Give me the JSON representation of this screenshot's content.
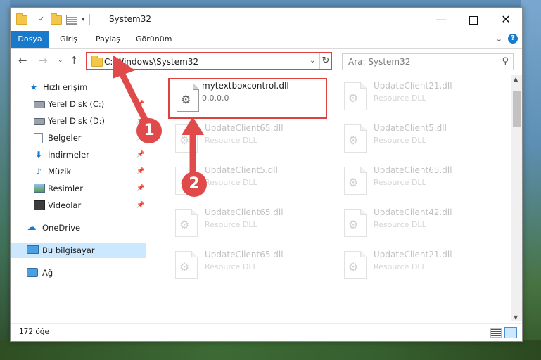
{
  "window": {
    "title": "System32",
    "qat_separator": "|",
    "qat_dropdown": "▾"
  },
  "ribbon": {
    "tabs": [
      "Dosya",
      "Giriş",
      "Paylaş",
      "Görünüm"
    ]
  },
  "navigation": {
    "address": "C:\\Windows\\System32",
    "search_placeholder": "Ara: System32"
  },
  "sidebar": {
    "items": [
      {
        "label": "Hızlı erişim",
        "icon": "star-icon"
      },
      {
        "label": "Yerel Disk (C:)",
        "icon": "drive-icon",
        "pinned": true
      },
      {
        "label": "Yerel Disk (D:)",
        "icon": "drive-icon",
        "pinned": true
      },
      {
        "label": "Belgeler",
        "icon": "documents-icon",
        "pinned": true
      },
      {
        "label": "İndirmeler",
        "icon": "download-icon",
        "pinned": true
      },
      {
        "label": "Müzik",
        "icon": "music-icon",
        "pinned": true
      },
      {
        "label": "Resimler",
        "icon": "pictures-icon",
        "pinned": true
      },
      {
        "label": "Videolar",
        "icon": "videos-icon",
        "pinned": true
      },
      {
        "label": "OneDrive",
        "icon": "onedrive-icon"
      },
      {
        "label": "Bu bilgisayar",
        "icon": "this-pc-icon",
        "selected": true
      },
      {
        "label": "Ağ",
        "icon": "network-icon"
      }
    ]
  },
  "files": [
    {
      "name": "mytextboxcontrol.dll",
      "sub": "0.0.0.0",
      "highlighted": true
    },
    {
      "name": "UpdateClient21.dll",
      "sub": "Resource DLL"
    },
    {
      "name": "UpdateClient65.dll",
      "sub": "Resource DLL"
    },
    {
      "name": "UpdateClient5.dll",
      "sub": "Resource DLL"
    },
    {
      "name": "UpdateClient5.dll",
      "sub": "Resource DLL"
    },
    {
      "name": "UpdateClient65.dll",
      "sub": "Resource DLL"
    },
    {
      "name": "UpdateClient65.dll",
      "sub": "Resource DLL"
    },
    {
      "name": "UpdateClient42.dll",
      "sub": "Resource DLL"
    },
    {
      "name": "UpdateClient65.dll",
      "sub": "Resource DLL"
    },
    {
      "name": "UpdateClient21.dll",
      "sub": "Resource DLL"
    }
  ],
  "status": {
    "item_count": "172 öğe"
  },
  "callouts": [
    "1",
    "2"
  ],
  "colors": {
    "accent": "#1979ca",
    "highlight_border": "#e04040",
    "callout_fill": "#e04a4a"
  }
}
